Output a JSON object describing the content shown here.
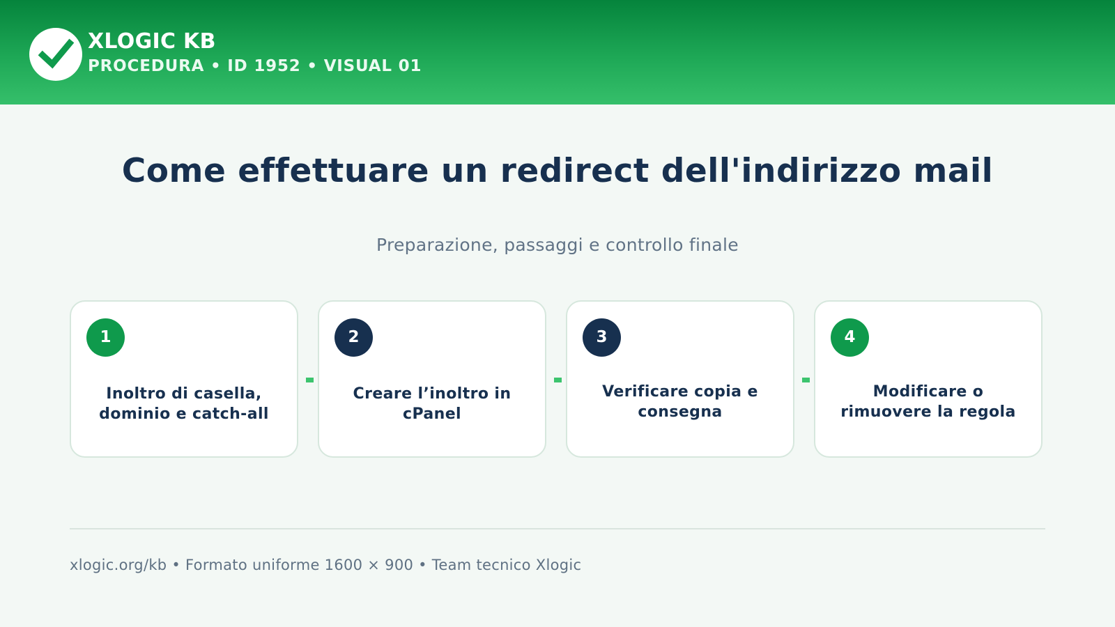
{
  "header": {
    "logo_icon": "check-mark-icon",
    "brand": "XLOGIC KB",
    "subtitle": "PROCEDURA • ID 1952 • VISUAL 01"
  },
  "main": {
    "title": "Come effettuare un redirect dell'indirizzo mail",
    "subtitle": "Preparazione, passaggi e controllo finale",
    "steps": [
      {
        "number": "1",
        "label": "Inoltro di casella, dominio e catch-all",
        "badge_color": "#0f9a4c"
      },
      {
        "number": "2",
        "label": "Creare l’inoltro in cPanel",
        "badge_color": "#17304f"
      },
      {
        "number": "3",
        "label": "Verificare copia e consegna",
        "badge_color": "#17304f"
      },
      {
        "number": "4",
        "label": "Modificare o rimuovere la regola",
        "badge_color": "#0f9a4c"
      }
    ]
  },
  "footer": {
    "text": "xlogic.org/kb • Formato uniforme 1600 × 900 • Team tecnico Xlogic"
  },
  "colors": {
    "brand_green": "#0f9a4c",
    "navy": "#17304f",
    "background": "#f3f8f5"
  }
}
